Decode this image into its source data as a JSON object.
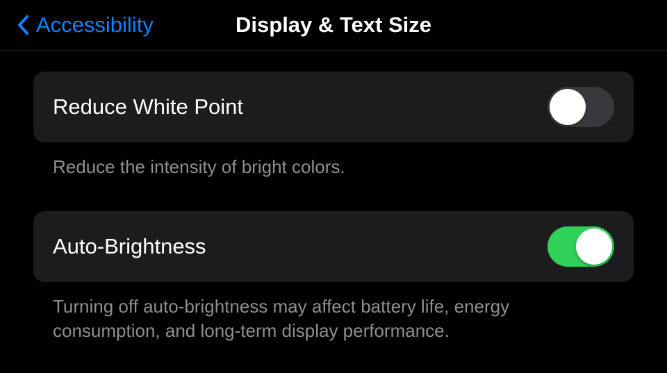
{
  "header": {
    "back_label": "Accessibility",
    "page_title": "Display & Text Size"
  },
  "settings": {
    "reduce_white_point": {
      "label": "Reduce White Point",
      "description": "Reduce the intensity of bright colors.",
      "enabled": false
    },
    "auto_brightness": {
      "label": "Auto-Brightness",
      "description": "Turning off auto-brightness may affect battery life, energy consumption, and long-term display performance.",
      "enabled": true
    }
  }
}
